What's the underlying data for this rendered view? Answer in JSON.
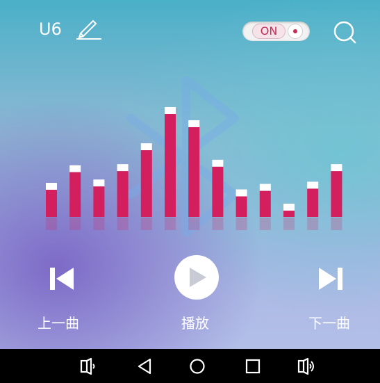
{
  "header": {
    "device_name": "U6",
    "toggle_label": "ON"
  },
  "equalizer": {
    "bar_levels": [
      0.31,
      0.47,
      0.34,
      0.48,
      0.67,
      1.0,
      0.88,
      0.52,
      0.25,
      0.3,
      0.12,
      0.32,
      0.48
    ],
    "bar_color": "#d41f5e",
    "cap_color": "#ffffff"
  },
  "controls": {
    "prev_label": "上一曲",
    "play_label": "播放",
    "next_label": "下一曲"
  },
  "navbar": {
    "icons": [
      "volume-down-icon",
      "back-icon",
      "home-icon",
      "recents-icon",
      "volume-up-icon"
    ]
  },
  "colors": {
    "accent": "#c52d58"
  }
}
